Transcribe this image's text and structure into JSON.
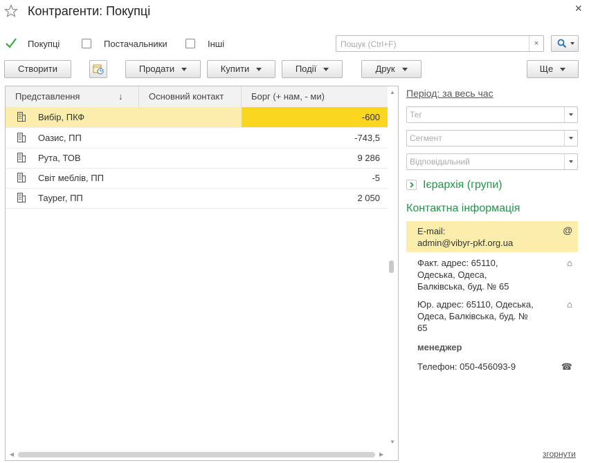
{
  "header": {
    "title": "Контрагенти: Покупці"
  },
  "filters": [
    {
      "label": "Покупці",
      "checked": true
    },
    {
      "label": "Постачальники",
      "checked": false
    },
    {
      "label": "Інші",
      "checked": false
    }
  ],
  "search": {
    "placeholder": "Пошук (Ctrl+F)",
    "clear_label": "×"
  },
  "toolbar": {
    "create": "Створити",
    "sell": "Продати",
    "buy": "Купити",
    "events": "Події",
    "print": "Друк",
    "more": "Ще"
  },
  "table": {
    "columns": [
      "Представлення",
      "Основний контакт",
      "Борг (+ нам, - ми)"
    ],
    "sort_indicator": "↓",
    "rows": [
      {
        "name": "Вибір, ПКФ",
        "contact": "",
        "debt": "-600",
        "selected": true
      },
      {
        "name": "Оазис, ПП",
        "contact": "",
        "debt": "-743,5"
      },
      {
        "name": "Рута, ТОВ",
        "contact": "",
        "debt": "9 286"
      },
      {
        "name": "Світ меблів, ПП",
        "contact": "",
        "debt": "-5"
      },
      {
        "name": "Тауреr, ПП",
        "contact": "",
        "debt": "2 050"
      }
    ]
  },
  "side": {
    "period": "Період: за весь час",
    "tag_placeholder": "Тег",
    "segment_placeholder": "Сегмент",
    "responsible_placeholder": "Відповідальний",
    "hierarchy": "Ієрархія (групи)",
    "contact_title": "Контактна інформація",
    "email_label": "E-mail:",
    "email_value": "admin@vibyr-pkf.org.ua",
    "fact_address": [
      "Факт. адрес: 65110,",
      "Одеська, Одеса,",
      "Балківська, буд. № 65"
    ],
    "legal_address": [
      "Юр. адрес: 65110, Одеська,",
      "Одеса, Балківська, буд. №",
      "65"
    ],
    "manager": "менеджер",
    "phone": "Телефон: 050-456093-9",
    "collapse": "згорнути"
  },
  "icons": {
    "email": "@",
    "home": "⌂",
    "phone": "☎"
  },
  "colors": {
    "selected_row": "#fbedab",
    "selected_debt_cell": "#fbd61f",
    "green_heading": "#1e9647",
    "checkmark": "#3aa641"
  }
}
